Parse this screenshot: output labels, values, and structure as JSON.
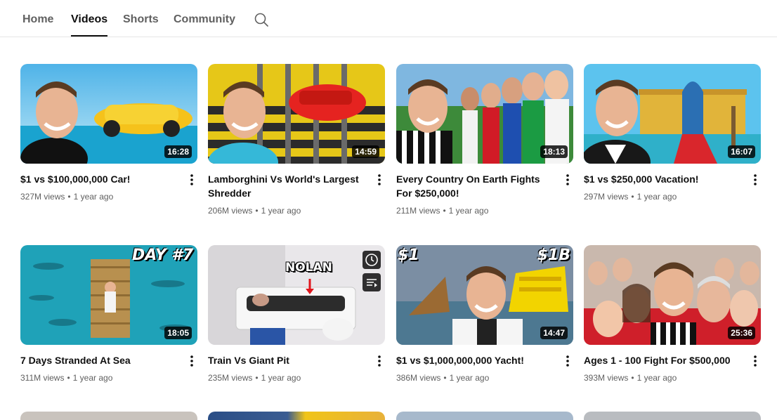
{
  "tabs": [
    {
      "label": "Home",
      "active": false
    },
    {
      "label": "Videos",
      "active": true
    },
    {
      "label": "Shorts",
      "active": false
    },
    {
      "label": "Community",
      "active": false
    }
  ],
  "search": {
    "icon": "search-icon"
  },
  "videos": [
    {
      "title": "$1 vs $100,000,000 Car!",
      "views": "327M views",
      "age": "1 year ago",
      "duration": "16:28"
    },
    {
      "title": "Lamborghini Vs World's Largest Shredder",
      "views": "206M views",
      "age": "1 year ago",
      "duration": "14:59"
    },
    {
      "title": "Every Country On Earth Fights For $250,000!",
      "views": "211M views",
      "age": "1 year ago",
      "duration": "18:13"
    },
    {
      "title": "$1 vs $250,000 Vacation!",
      "views": "297M views",
      "age": "1 year ago",
      "duration": "16:07"
    },
    {
      "title": "7 Days Stranded At Sea",
      "views": "311M views",
      "age": "1 year ago",
      "duration": "18:05",
      "thumb_text": "DAY #7"
    },
    {
      "title": "Train Vs Giant Pit",
      "views": "235M views",
      "age": "1 year ago",
      "thumb_text": "NOLAN"
    },
    {
      "title": "$1 vs $1,000,000,000 Yacht!",
      "views": "386M views",
      "age": "1 year ago",
      "duration": "14:47",
      "thumb_text_left": "$1",
      "thumb_text_right": "$1B"
    },
    {
      "title": "Ages 1 - 100 Fight For $500,000",
      "views": "393M views",
      "age": "1 year ago",
      "duration": "25:36"
    }
  ],
  "colors": {
    "text_primary": "#0f0f0f",
    "text_secondary": "#606060",
    "divider": "#e5e5e5"
  }
}
